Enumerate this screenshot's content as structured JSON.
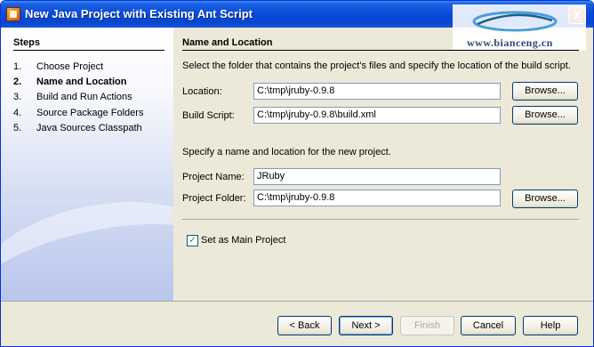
{
  "window": {
    "title": "New Java Project with Existing Ant Script",
    "close_glyph": "X"
  },
  "watermark": {
    "text": "www.bianceng.cn"
  },
  "steps": {
    "title": "Steps",
    "items": [
      {
        "num": "1.",
        "label": "Choose Project"
      },
      {
        "num": "2.",
        "label": "Name and Location"
      },
      {
        "num": "3.",
        "label": "Build and Run Actions"
      },
      {
        "num": "4.",
        "label": "Source Package Folders"
      },
      {
        "num": "5.",
        "label": "Java Sources Classpath"
      }
    ]
  },
  "panel": {
    "title": "Name and Location",
    "desc1": "Select the folder that contains the project's files and specify the location of the build script.",
    "desc2": "Specify a name and location for the new project.",
    "location": {
      "label": "Location:",
      "value": "C:\\tmp\\jruby-0.9.8",
      "browse": "Browse..."
    },
    "build_script": {
      "label": "Build Script:",
      "value": "C:\\tmp\\jruby-0.9.8\\build.xml",
      "browse": "Browse..."
    },
    "project_name": {
      "label": "Project Name:",
      "value": "JRuby"
    },
    "project_folder": {
      "label": "Project Folder:",
      "value": "C:\\tmp\\jruby-0.9.8",
      "browse": "Browse..."
    },
    "main_project": {
      "label": "Set as Main Project",
      "checked": true
    }
  },
  "buttons": {
    "back": "< Back",
    "next": "Next >",
    "finish": "Finish",
    "cancel": "Cancel",
    "help": "Help"
  },
  "colors": {
    "title_bar": "#0a4cd6",
    "dialog_bg": "#ece9d8",
    "accent_border": "#003c74"
  }
}
